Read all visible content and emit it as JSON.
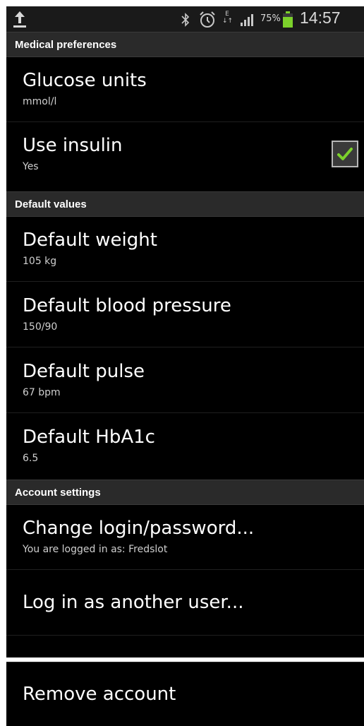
{
  "status_bar": {
    "battery_percent": "75%",
    "time": "14:57",
    "network_label": "E",
    "battery_level": 0.75,
    "battery_color": "#7cd12b"
  },
  "sections": {
    "medical": {
      "header": "Medical preferences",
      "glucose": {
        "title": "Glucose units",
        "summary": "mmol/l"
      },
      "insulin": {
        "title": "Use insulin",
        "summary": "Yes",
        "checked": true
      }
    },
    "defaults": {
      "header": "Default values",
      "weight": {
        "title": "Default weight",
        "summary": "105 kg"
      },
      "blood_pressure": {
        "title": "Default blood pressure",
        "summary": "150/90"
      },
      "pulse": {
        "title": "Default pulse",
        "summary": "67 bpm"
      },
      "hba1c": {
        "title": "Default HbA1c",
        "summary": "6.5"
      }
    },
    "account": {
      "header": "Account settings",
      "change_login": {
        "title": "Change login/password...",
        "summary": "You are logged in as: Fredslot"
      },
      "another_user": {
        "title": "Log in as another user..."
      },
      "remove_account": {
        "title": "Remove account"
      }
    }
  },
  "icons": {
    "upload": "upload-icon",
    "bluetooth": "bluetooth-icon",
    "alarm": "alarm-icon",
    "signal": "signal-icon",
    "battery": "battery-icon",
    "checkmark": "checkmark-icon"
  },
  "colors": {
    "check_green": "#7cd12b",
    "section_header_bg": "#2a2a2a"
  }
}
